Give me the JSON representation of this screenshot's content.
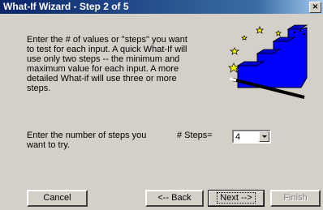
{
  "window": {
    "title": "What-If Wizard - Step 2 of 5",
    "close_label": "×"
  },
  "intro_text": "Enter the # of values or \"steps\" you want\nto test for each input.  A quick What-If will\nuse only two steps -- the minimum and\nmaximum value for each input.  A more\ndetailed What-if will use three or more\nsteps.",
  "steps_prompt": "Enter the number of steps you\nwant to try.",
  "steps_field": {
    "label": "# Steps=",
    "value": "4"
  },
  "buttons": {
    "cancel": "Cancel",
    "back": "<-- Back",
    "next": "Next -->",
    "finish": "Finish"
  },
  "illustration": {
    "icon": "wizard-staircase-wand",
    "stair_color": "#0000ff",
    "star_color": "#ffff00"
  }
}
